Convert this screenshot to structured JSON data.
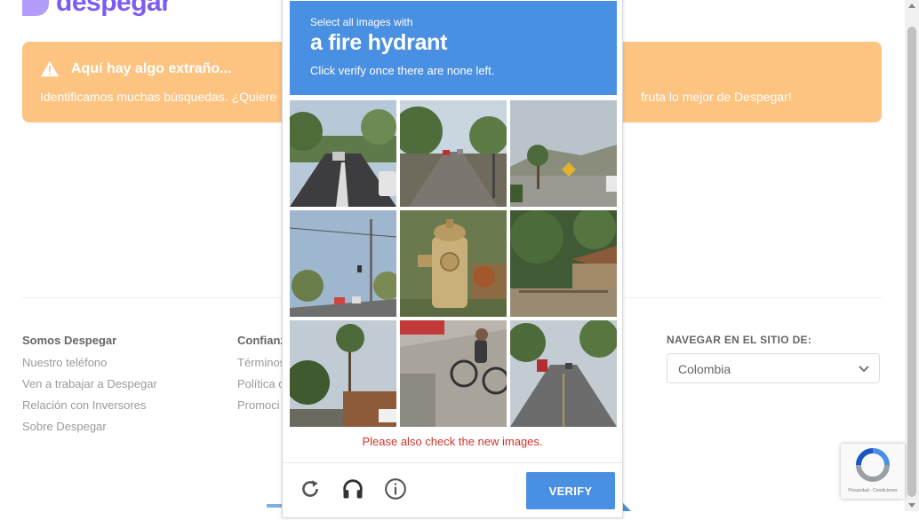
{
  "brand": {
    "name": "despegar"
  },
  "alert": {
    "title": "Aquí hay algo extraño...",
    "text_left": "Identificamos muchas búsquedas. ¿Quiere",
    "text_right": "fruta lo mejor de Despegar!"
  },
  "footer": {
    "col1": {
      "heading": "Somos Despegar",
      "links": [
        "Nuestro teléfono",
        "Ven a trabajar a Despegar",
        "Relación con Inversores",
        "Sobre Despegar"
      ]
    },
    "col2": {
      "heading": "Confianz",
      "links": [
        "Términos",
        "Política d",
        "Promoci"
      ]
    },
    "nav_site": {
      "heading": "NAVEGAR EN EL SITIO DE:",
      "selected": "Colombia"
    }
  },
  "captcha": {
    "instruction_line1": "Select all images with",
    "target": "a fire hydrant",
    "instruction_line3": "Click verify once there are none left.",
    "message": "Please also check the new images.",
    "verify_label": "VERIFY",
    "tiles": [
      {
        "scene": "road-with-cars"
      },
      {
        "scene": "residential-street"
      },
      {
        "scene": "roadside-with-palms"
      },
      {
        "scene": "street-with-power-pole"
      },
      {
        "scene": "fire-hydrant-closeup"
      },
      {
        "scene": "house-with-palms"
      },
      {
        "scene": "palm-tree-building"
      },
      {
        "scene": "man-on-bicycle"
      },
      {
        "scene": "street-with-bus"
      }
    ],
    "icons": [
      "reload-icon",
      "audio-icon",
      "info-icon"
    ]
  },
  "recaptcha_badge": {
    "terms": "Privacidad - Condiciones"
  },
  "colors": {
    "alert": "#fdc381",
    "captcha_blue": "#4a90e2",
    "error": "#d0342c"
  }
}
